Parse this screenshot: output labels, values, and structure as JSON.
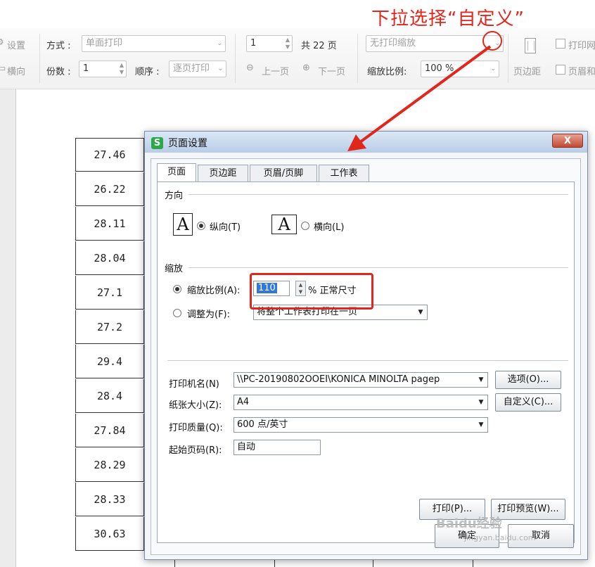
{
  "annotation": {
    "text": "下拉选择“自定义”"
  },
  "toolbar": {
    "settings": "设置",
    "landscape": "横向",
    "mode_label": "方式 :",
    "mode_value": "单面打印",
    "copies_label": "份数 :",
    "copies_value": "1",
    "order_label": "顺序 :",
    "order_value": "逐页打印",
    "page_value": "1",
    "total_pages": "共 22 页",
    "prev_page": "上一页",
    "next_page": "下一页",
    "scale_select": "无打印缩放",
    "scale_label": "缩放比例:",
    "scale_value": "100 %",
    "margins": "页边距",
    "print_partial": "打印网",
    "header_partial": "页眉和"
  },
  "sheet": {
    "values": [
      "27.46",
      "26.22",
      "28.11",
      "28.04",
      "27.1",
      "27.2",
      "29.4",
      "28.4",
      "27.84",
      "28.29",
      "28.33",
      "30.63"
    ]
  },
  "dialog": {
    "title": "页面设置",
    "close": "X",
    "tabs": [
      "页面",
      "页边距",
      "页眉/页脚",
      "工作表"
    ],
    "orientation_label": "方向",
    "portrait": "纵向(T)",
    "landscape": "横向(L)",
    "scaling_label": "缩放",
    "scale_ratio_label": "缩放比例(A):",
    "scale_ratio_value": "110",
    "scale_unit": "% 正常尺寸",
    "fit_to_label": "调整为(F):",
    "fit_to_value": "将整个工作表打印在一页",
    "printer_label": "打印机名(N)",
    "printer_value": "\\\\PC-20190802OOEI\\KONICA MINOLTA pagep",
    "options_button": "选项(O)...",
    "paper_label": "纸张大小(Z):",
    "paper_value": "A4",
    "custom_button": "自定义(C)...",
    "quality_label": "打印质量(Q):",
    "quality_value": "600 点/英寸",
    "first_page_label": "起始页码(R):",
    "first_page_value": "自动",
    "print_button": "打印(P)...",
    "preview_button": "打印预览(W)...",
    "ok_button": "确定",
    "cancel_button": "取消"
  },
  "watermark": {
    "text": "Baidu经验",
    "sub": "jingyan.baidu.com"
  },
  "colors": {
    "annotation": "#e1261c",
    "accent": "#3278d8"
  }
}
